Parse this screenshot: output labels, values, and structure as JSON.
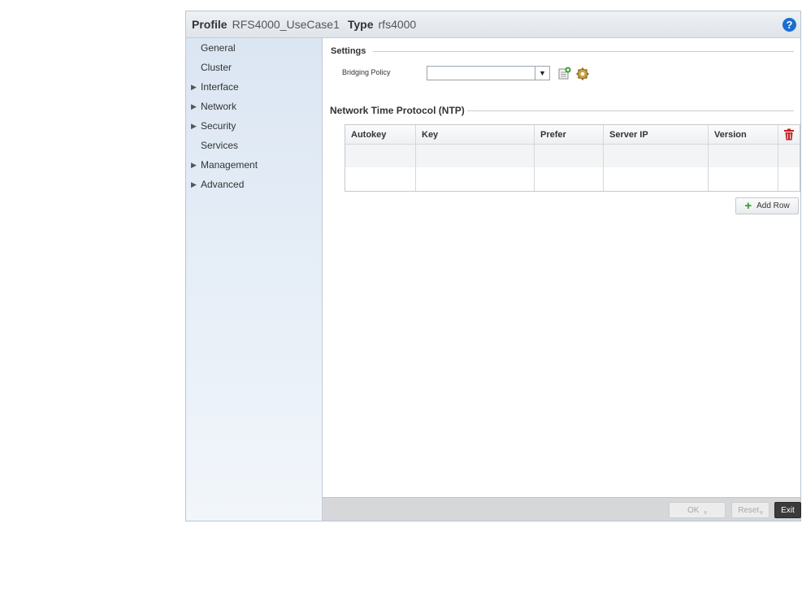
{
  "header": {
    "profile_label": "Profile",
    "profile_value": "RFS4000_UseCase1",
    "type_label": "Type",
    "type_value": "rfs4000",
    "help_icon": "?"
  },
  "sidebar": {
    "items": [
      {
        "label": "General",
        "expandable": false
      },
      {
        "label": "Cluster",
        "expandable": false
      },
      {
        "label": "Interface",
        "expandable": true
      },
      {
        "label": "Network",
        "expandable": true
      },
      {
        "label": "Security",
        "expandable": true
      },
      {
        "label": "Services",
        "expandable": false
      },
      {
        "label": "Management",
        "expandable": true
      },
      {
        "label": "Advanced",
        "expandable": true
      }
    ]
  },
  "settings": {
    "title": "Settings",
    "bridging_policy_label": "Bridging Policy",
    "bridging_policy_value": ""
  },
  "ntp": {
    "title": "Network Time Protocol (NTP)",
    "columns": [
      "Autokey",
      "Key",
      "Prefer",
      "Server IP",
      "Version"
    ],
    "rows": [],
    "add_row_label": "Add Row"
  },
  "footer": {
    "ok_label": "OK",
    "ok_sub": "x",
    "reset_label": "Reset",
    "reset_sub": "x",
    "exit_label": "Exit"
  },
  "colors": {
    "accent_blue": "#1a6fd1",
    "delete_red": "#c0201f",
    "add_green": "#2a9a2a"
  }
}
